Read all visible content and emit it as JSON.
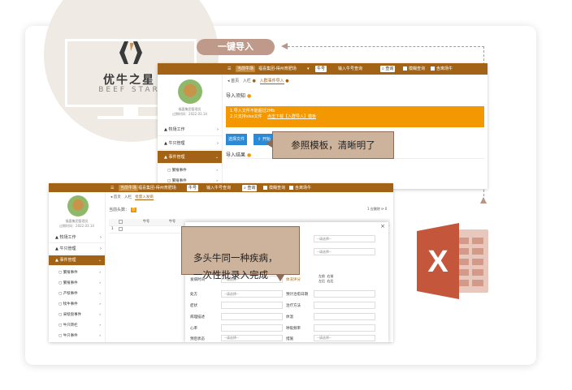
{
  "banner_label": "一键导入",
  "brand": {
    "name": "优牛之星",
    "sub": "BEEF STAR"
  },
  "callouts": {
    "template": "参照模板，清晰明了",
    "batch": "多头牛同一种疾病，\n一次性批录入完成"
  },
  "screen1": {
    "farm_tag": "当前牛场",
    "farm_name": "福喜集团-得州育肥场",
    "search_type": "牛号",
    "search_placeholder": "输入牛号查询",
    "search_button": "查询",
    "fuzzy": "模糊查询",
    "include_out": "含离场牛",
    "user": "福喜集团管理员",
    "expire": "过期时间：2022.03.14",
    "menu": [
      "牧场工作",
      "牛只管理",
      "事件管理"
    ],
    "submenu": [
      "繁殖事件",
      "繁殖事件"
    ],
    "tabs": [
      "首页",
      "入栏",
      "入群事件导入"
    ],
    "panel_title": "导入须知",
    "notice_lines": [
      "1.导入文件不能超过2Mb",
      "2.只支持xlsx文件"
    ],
    "notice_link": "点击下载【入群导入】模板",
    "choose_file": "选择文件",
    "start": "开始",
    "result_title": "导入结果"
  },
  "screen2": {
    "farm_tag": "当前牛场",
    "farm_name": "福喜集团-得州育肥场",
    "search_type": "牛号",
    "search_placeholder": "输入牛号查询",
    "search_button": "查询",
    "fuzzy": "模糊查询",
    "include_out": "含离场牛",
    "user": "福喜集团管理员",
    "expire": "过期时间：2022.03.14",
    "menu": [
      "牧场工作",
      "牛只管理",
      "事件管理"
    ],
    "submenu": [
      "繁殖事件",
      "繁殖事件",
      "产犊事件",
      "犊牛事件",
      "采犊盘事件",
      "牛只转栏",
      "牛只事件"
    ],
    "tabs": [
      "首页",
      "入栏",
      "批量入发病"
    ],
    "current_cows": "当前头数：",
    "count_badge": "0",
    "toolbar_right": [
      "1 应删除",
      "0"
    ],
    "grid_headers": [
      "",
      "",
      "牛号",
      "牛号"
    ],
    "grid_rows": [
      [
        "1",
        ""
      ]
    ],
    "modal_fields": [
      {
        "label": "发病时间",
        "value": "--请选择--"
      },
      {
        "label": "病因",
        "value": "--请选择--"
      },
      {
        "label": "处方",
        "value": "--请选择--"
      },
      {
        "label": "症状",
        "value": ""
      },
      {
        "label": "病理描述",
        "value": ""
      },
      {
        "label": "心率",
        "value": ""
      },
      {
        "label": "预后状态",
        "value": "--请选择--"
      }
    ],
    "modal_fields_right": [
      {
        "label": "",
        "value": "--请选择--"
      },
      {
        "label": "",
        "value": "--请选择--"
      },
      {
        "label": "体况评分",
        "value": ""
      },
      {
        "label": "预计治愈日期",
        "value": ""
      },
      {
        "label": "治疗方法",
        "value": ""
      },
      {
        "label": "体温",
        "value": ""
      },
      {
        "label": "呼吸频率",
        "value": ""
      },
      {
        "label": "措施",
        "value": "--请选择--"
      }
    ],
    "dairy_labels": [
      "左前",
      "右前",
      "左后",
      "右后"
    ]
  },
  "excel_letter": "X",
  "colors": {
    "brand": "#a26317",
    "alert": "#f39800",
    "callout": "#ceb39c",
    "excel": "#c4563c"
  }
}
